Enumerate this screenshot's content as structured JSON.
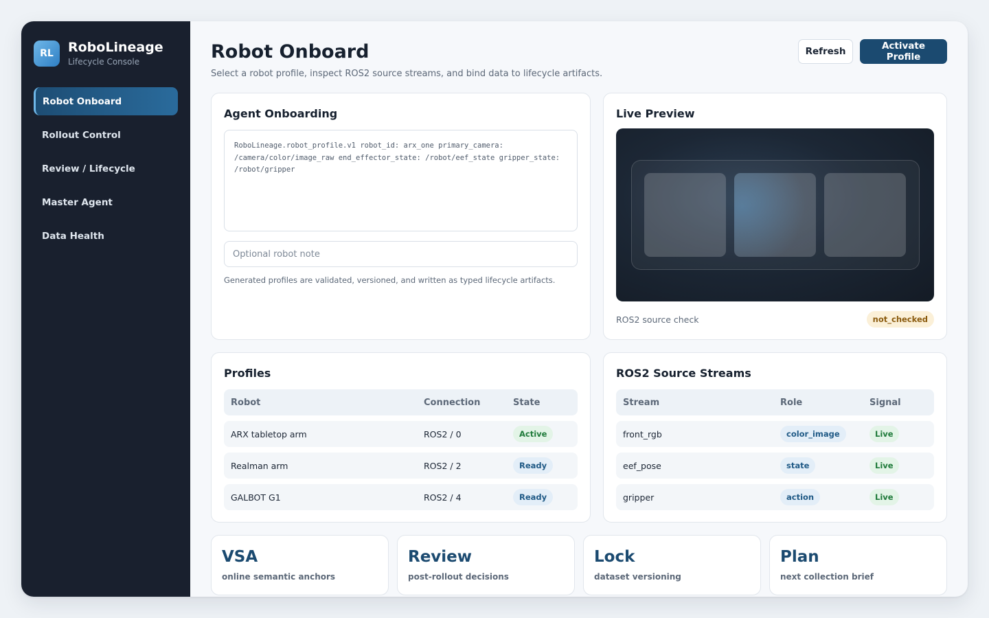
{
  "brand": {
    "logo": "RL",
    "title": "RoboLineage",
    "subtitle": "Lifecycle Console"
  },
  "nav": [
    {
      "label": "Robot Onboard",
      "active": true
    },
    {
      "label": "Rollout Control"
    },
    {
      "label": "Review / Lifecycle"
    },
    {
      "label": "Master Agent"
    },
    {
      "label": "Data Health"
    }
  ],
  "header": {
    "title": "Robot Onboard",
    "subtitle": "Select a robot profile, inspect ROS2 source streams, and bind data to lifecycle artifacts.",
    "refresh_label": "Refresh",
    "activate_label": "Activate Profile"
  },
  "onboarding": {
    "title": "Agent Onboarding",
    "profile_text": "RoboLineage.robot_profile.v1 robot_id: arx_one primary_camera: /camera/color/image_raw end_effector_state: /robot/eef_state gripper_state: /robot/gripper",
    "note_placeholder": "Optional robot note",
    "note_value": "",
    "helper": "Generated profiles are validated, versioned, and written as typed lifecycle artifacts."
  },
  "preview": {
    "title": "Live Preview",
    "source_label": "ROS2 source check",
    "status": "not_checked"
  },
  "profiles": {
    "title": "Profiles",
    "columns": [
      "Robot",
      "Connection",
      "State"
    ],
    "rows": [
      {
        "robot": "ARX tabletop arm",
        "connection": "ROS2 / 0",
        "state": "Active"
      },
      {
        "robot": "Realman arm",
        "connection": "ROS2 / 2",
        "state": "Ready"
      },
      {
        "robot": "GALBOT G1",
        "connection": "ROS2 / 4",
        "state": "Ready"
      }
    ]
  },
  "streams": {
    "title": "ROS2 Source Streams",
    "columns": [
      "Stream",
      "Role",
      "Signal"
    ],
    "rows": [
      {
        "stream": "front_rgb",
        "role": "color_image",
        "signal": "Live"
      },
      {
        "stream": "eef_pose",
        "role": "state",
        "signal": "Live"
      },
      {
        "stream": "gripper",
        "role": "action",
        "signal": "Live"
      }
    ]
  },
  "stats": [
    {
      "title": "VSA",
      "subtitle": "online semantic anchors"
    },
    {
      "title": "Review",
      "subtitle": "post-rollout decisions"
    },
    {
      "title": "Lock",
      "subtitle": "dataset versioning"
    },
    {
      "title": "Plan",
      "subtitle": "next collection brief"
    }
  ],
  "colors": {
    "sidebar": "#19202e",
    "accent": "#1b4a70",
    "active_nav": "#2a6b9c"
  }
}
